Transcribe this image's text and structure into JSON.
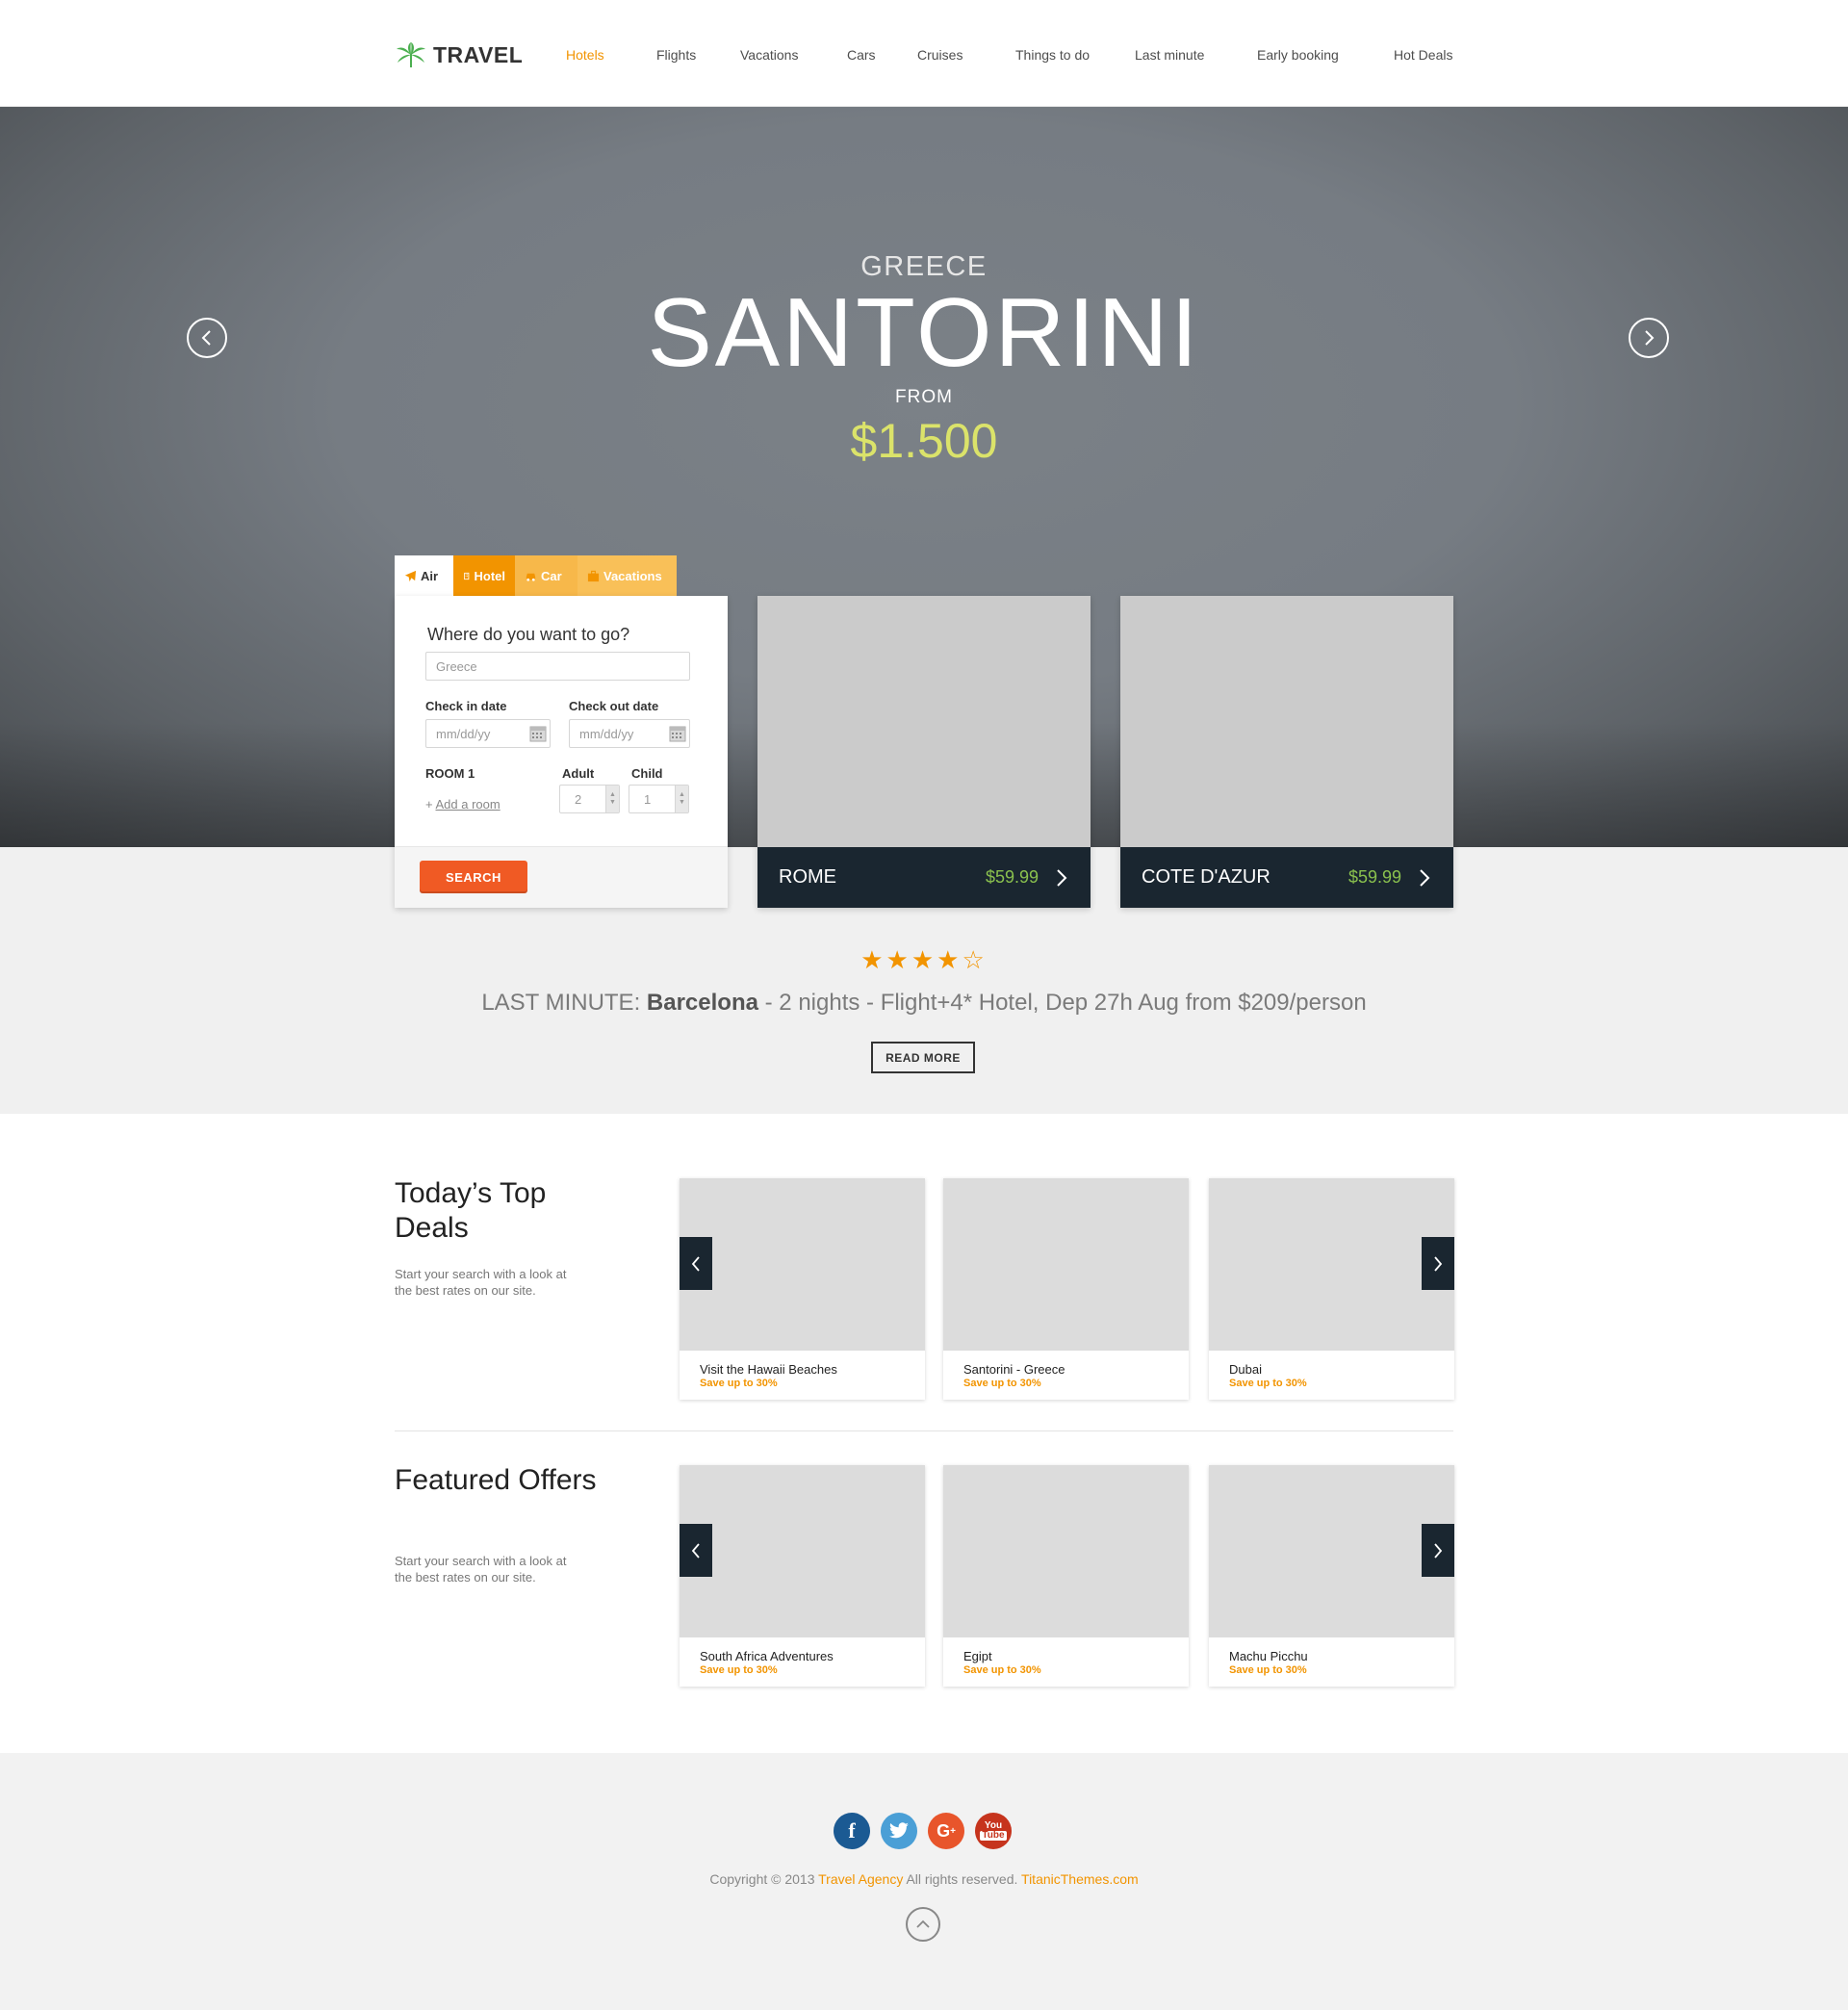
{
  "header": {
    "logo_text": "TRAVEL",
    "nav": [
      "Hotels",
      "Flights",
      "Vacations",
      "Cars",
      "Cruises",
      "Things to do",
      "Last minute",
      "Early booking",
      "Hot Deals"
    ],
    "active_nav": "Hotels"
  },
  "hero": {
    "country": "GREECE",
    "city": "SANTORINI",
    "from_label": "FROM",
    "price": "$1.500",
    "prev_icon": "chevron-left-circle-icon",
    "next_icon": "chevron-right-circle-icon"
  },
  "search": {
    "tabs": [
      "Air",
      "Hotel",
      "Car",
      "Vacations"
    ],
    "active_tab": "Air",
    "title": "Where do you want to go?",
    "destination_value": "Greece",
    "checkin_label": "Check in date",
    "checkin_placeholder": "mm/dd/yy",
    "checkout_label": "Check out date",
    "checkout_placeholder": "mm/dd/yy",
    "room_label": "ROOM 1",
    "adult_label": "Adult",
    "adult_value": "2",
    "child_label": "Child",
    "child_value": "1",
    "add_room_prefix": "+",
    "add_room": "Add a room",
    "button": "SEARCH"
  },
  "destinations": [
    {
      "name": "ROME",
      "price": "$59.99"
    },
    {
      "name": "COTE D'AZUR",
      "price": "$59.99"
    }
  ],
  "last_minute": {
    "rating": 4,
    "rating_max": 5,
    "stars_text": "★★★★☆",
    "prefix": "LAST MINUTE:",
    "place": "Barcelona",
    "details": "- 2 nights - Flight+4* Hotel, Dep 27h Aug from $209/person",
    "button": "READ MORE"
  },
  "top_deals": {
    "title": "Today’s Top Deals",
    "description": "Start your search with a look at the best rates on our site.",
    "items": [
      {
        "title": "Visit the Hawaii Beaches",
        "subtitle": "Save up to 30%"
      },
      {
        "title": "Santorini - Greece",
        "subtitle": "Save up to 30%"
      },
      {
        "title": "Dubai",
        "subtitle": "Save up to 30%"
      }
    ]
  },
  "featured": {
    "title": "Featured Offers",
    "description": "Start your search with a look at the best rates on our site.",
    "items": [
      {
        "title": "South Africa Adventures",
        "subtitle": "Save up to 30%"
      },
      {
        "title": "Egipt",
        "subtitle": "Save up to 30%"
      },
      {
        "title": "Machu Picchu",
        "subtitle": "Save up to 30%"
      }
    ]
  },
  "footer": {
    "social": [
      {
        "icon": "facebook-icon",
        "color": "#1b5a93"
      },
      {
        "icon": "twitter-icon",
        "color": "#4a9fd6"
      },
      {
        "icon": "google-plus-icon",
        "color": "#e8552b"
      },
      {
        "icon": "youtube-icon",
        "color": "#c6341d"
      }
    ],
    "copyright_prefix": "Copyright © 2013",
    "agency": "Travel Agency",
    "rights": "All rights reserved.",
    "site": "TitanicThemes.com"
  },
  "colors": {
    "accent": "#f29400",
    "search_button": "#f05a24",
    "dark_panel": "#1a2630",
    "price_green": "#8ac14e",
    "hero_price": "#dbe36a"
  }
}
